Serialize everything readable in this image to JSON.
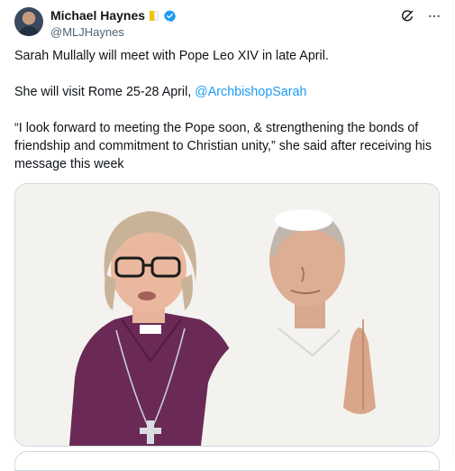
{
  "post": {
    "author": {
      "display_name": "Michael Haynes",
      "handle": "@MLJHaynes",
      "badges": [
        "vatican-flag-icon",
        "verified-badge-icon"
      ],
      "verified_color": "#1d9bf0"
    },
    "actions": {
      "grok_icon": "grok-icon",
      "more_icon": "more-icon"
    },
    "text": {
      "line1": "Sarah Mullally will meet with Pope Leo XIV in late April.",
      "line2_prefix": "She will visit Rome 25-28 April, ",
      "mention": "@ArchbishopSarah",
      "quote": "“I look forward to meeting the Pope soon, & strengthening the bonds of friendship and commitment to Christian unity,” she said after receiving his message this week"
    },
    "media": {
      "type": "photo"
    },
    "colors": {
      "text": "#0f1419",
      "secondary": "#536471",
      "link": "#1d9bf0",
      "border": "#cfd9de"
    }
  }
}
